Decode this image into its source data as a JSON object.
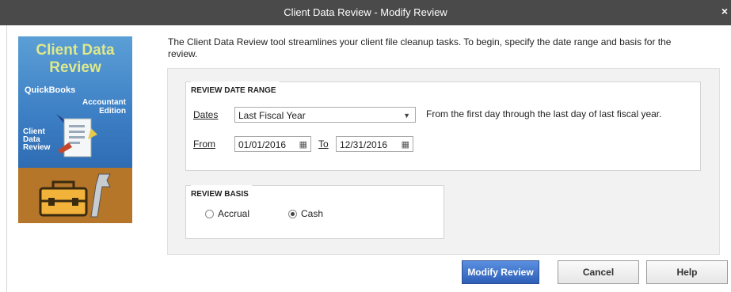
{
  "window": {
    "title": "Client Data Review - Modify Review",
    "close_glyph": "×"
  },
  "sidepanel": {
    "heading_line1": "Client Data",
    "heading_line2": "Review",
    "brand": "QuickBooks",
    "edition_line1": "Accountant",
    "edition_line2": "Edition",
    "doc_line1": "Client",
    "doc_line2": "Data",
    "doc_line3": "Review"
  },
  "intro_text": "The Client Data Review tool streamlines your client file cleanup tasks. To begin, specify the date range and basis for the review.",
  "date_range": {
    "group_title": "REVIEW DATE RANGE",
    "dates_label": "Dates",
    "dates_value": "Last Fiscal Year",
    "dates_description": "From the first day through the last day of last fiscal year.",
    "from_label": "From",
    "from_value": "01/01/2016",
    "to_label": "To",
    "to_value": "12/31/2016"
  },
  "basis": {
    "group_title": "REVIEW BASIS",
    "options": [
      {
        "label": "Accrual",
        "selected": false
      },
      {
        "label": "Cash",
        "selected": true
      }
    ]
  },
  "buttons": {
    "modify": "Modify Review",
    "cancel": "Cancel",
    "help": "Help"
  },
  "colors": {
    "titlebar": "#4a4a4a",
    "primary_button": "#2e5fb8",
    "side_blue": "#3d7fc4",
    "side_brown": "#b5762a",
    "heading_yellow": "#dfe98a"
  }
}
